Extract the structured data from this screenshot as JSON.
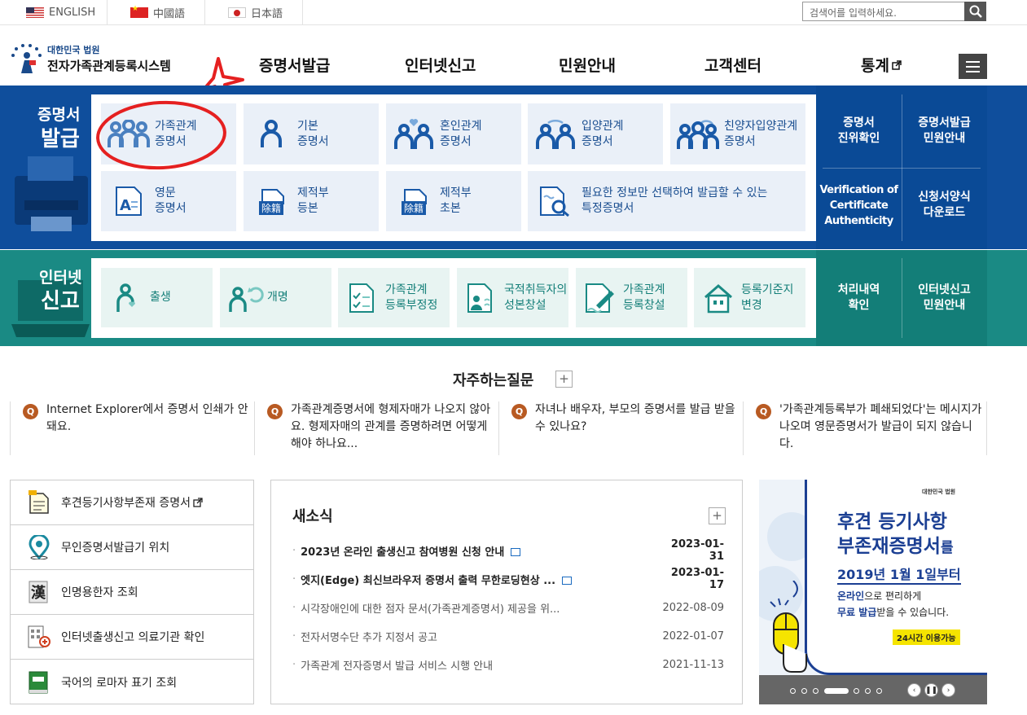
{
  "lang_bar": {
    "langs": [
      {
        "label": "ENGLISH",
        "flag": "us-flag-icon"
      },
      {
        "label": "中國語",
        "flag": "cn-flag-icon"
      },
      {
        "label": "日本語",
        "flag": "jp-flag-icon"
      }
    ],
    "search_placeholder": "검색어를 입력하세요."
  },
  "header": {
    "logo_small": "대한민국 법원",
    "logo_big": "전자가족관계등록시스템",
    "gnb": [
      "증명서발급",
      "인터넷신고",
      "민원안내",
      "고객센터",
      "통계"
    ]
  },
  "certificate": {
    "title_1": "증명서",
    "title_2": "발급",
    "tiles": [
      {
        "l1": "가족관계",
        "l2": "증명서"
      },
      {
        "l1": "기본",
        "l2": "증명서"
      },
      {
        "l1": "혼인관계",
        "l2": "증명서"
      },
      {
        "l1": "입양관계",
        "l2": "증명서"
      },
      {
        "l1": "친양자입양관계",
        "l2": "증명서"
      },
      {
        "l1": "영문",
        "l2": "증명서"
      },
      {
        "l1": "제적부",
        "l2": "등본"
      },
      {
        "l1": "제적부",
        "l2": "초본"
      },
      {
        "l1": "필요한 정보만 선택하여 발급할 수 있는",
        "l2": "특정증명서"
      }
    ],
    "badge": "除籍",
    "side": [
      {
        "l1": "증명서",
        "l2": "진위확인"
      },
      {
        "l1": "증명서발급",
        "l2": "민원안내"
      },
      {
        "l1": "Verification of",
        "l2": "Certificate",
        "l3": "Authenticity"
      },
      {
        "l1": "신청서양식",
        "l2": "다운로드"
      }
    ]
  },
  "report": {
    "title_1": "인터넷",
    "title_2": "신고",
    "tiles": [
      {
        "l1": "출생",
        "l2": ""
      },
      {
        "l1": "개명",
        "l2": ""
      },
      {
        "l1": "가족관계",
        "l2": "등록부정정"
      },
      {
        "l1": "국적취득자의",
        "l2": "성본창설"
      },
      {
        "l1": "가족관계",
        "l2": "등록창설"
      },
      {
        "l1": "등록기준지",
        "l2": "변경"
      }
    ],
    "side": [
      {
        "l1": "처리내역",
        "l2": "확인"
      },
      {
        "l1": "인터넷신고",
        "l2": "민원안내"
      }
    ]
  },
  "faq": {
    "title": "자주하는질문",
    "q_label": "Q",
    "items": [
      {
        "text": "Internet Explorer에서 증명서 인쇄가 안돼요."
      },
      {
        "text": "가족관계증명서에 형제자매가 나오지 않아요. 형제자매의 관계를 증명하려면 어떻게 해야 하나요..."
      },
      {
        "text": "자녀나 배우자, 부모의 증명서를 발급 받을 수 있나요?"
      },
      {
        "text": "'가족관계등록부가 폐쇄되었다'는 메시지가 나오며 영문증명서가 발급이 되지 않습니다."
      }
    ]
  },
  "quick": [
    {
      "label": "후견등기사항부존재 증명서",
      "icon": "document-icon"
    },
    {
      "label": "무인증명서발급기 위치",
      "icon": "location-pin-icon"
    },
    {
      "label": "인명용한자 조회",
      "icon": "hanja-book-icon"
    },
    {
      "label": "인터넷출생신고 의료기관 확인",
      "icon": "hospital-icon"
    },
    {
      "label": "국어의 로마자 표기 조회",
      "icon": "green-book-icon"
    }
  ],
  "news": {
    "title": "새소식",
    "items": [
      {
        "title": "2023년 온라인 출생신고 참여병원 신청 안내",
        "date": "2023-01-31",
        "bold": true
      },
      {
        "title": "엣지(Edge) 최신브라우저 증명서 출력 무한로딩현상 ...",
        "date": "2023-01-17",
        "bold": true
      },
      {
        "title": "시각장애인에 대한 점자 문서(가족관계증명서) 제공을 위...",
        "date": "2022-08-09",
        "bold": false
      },
      {
        "title": "전자서명수단 추가 지정서 공고",
        "date": "2022-01-07",
        "bold": false
      },
      {
        "title": "가족관계 전자증명서 발급 서비스 시행 안내",
        "date": "2021-11-13",
        "bold": false
      }
    ]
  },
  "banner": {
    "org": "대한민국 법원",
    "title_1": "후견 등기사항",
    "title_2a": "부존재증명서",
    "title_2b": "를",
    "date": "2019년 1월 1일부터",
    "line1a": "온라인",
    "line1b": "으로 편리하게",
    "line2a": "무료 발급",
    "line2b": "받을 수 있습니다.",
    "tag": "24시간 이용가능"
  },
  "colors": {
    "blue": "#0f4e9c",
    "green": "#1a8a84",
    "accent": "#b85a22"
  }
}
